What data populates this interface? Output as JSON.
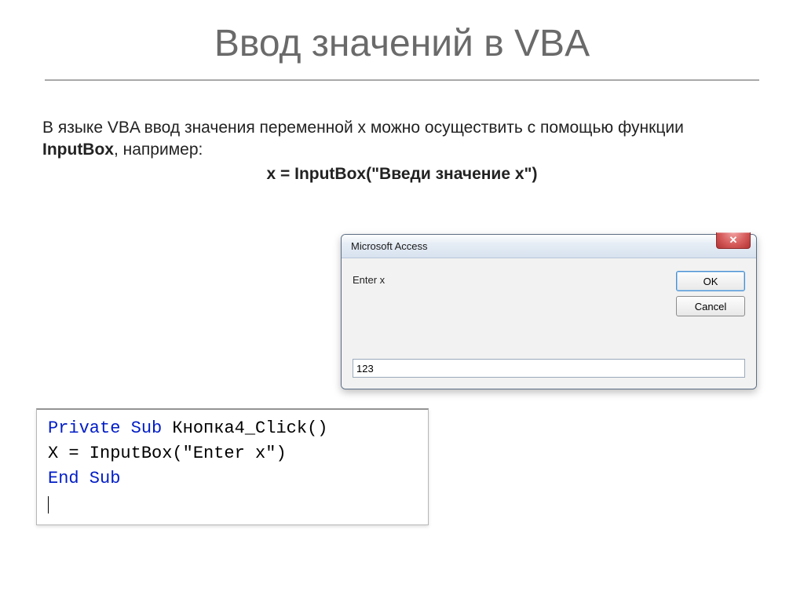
{
  "slide": {
    "title": "Ввод значений в VBA",
    "para1_a": "В языке VBA ввод значения переменной x можно осуществить с помощью функции ",
    "func": "InputBox",
    "para1_b": ", например:",
    "example": "x = InputBox(\"Введи значение x\")"
  },
  "dialog": {
    "title": "Microsoft Access",
    "close_glyph": "✕",
    "prompt": "Enter x",
    "ok_label": "OK",
    "cancel_label": "Cancel",
    "input_value": "123"
  },
  "code": {
    "l1_a": "Private Sub",
    "l1_b": " Кнопка4_Click()",
    "l2": "X = InputBox(\"Enter x\")",
    "l3": "End Sub"
  }
}
